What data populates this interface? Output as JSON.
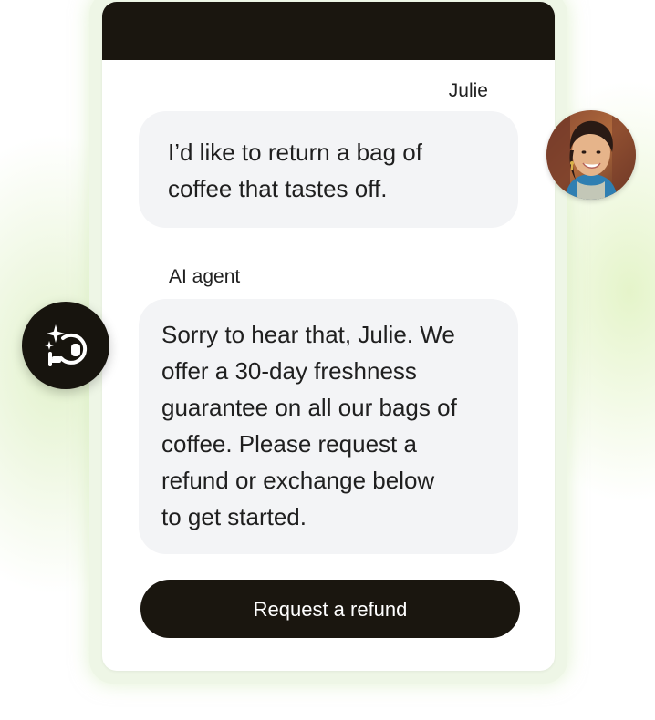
{
  "chat": {
    "messages": [
      {
        "sender": "Julie",
        "text": "I'd like to return a bag of coffee that tastes off.",
        "line1": "I’d like to return a bag of",
        "line2": "coffee that tastes off."
      },
      {
        "sender": "AI agent",
        "line1": "Sorry to hear that, Julie. We",
        "line2": "offer a 30-day freshness",
        "line3": "guarantee on all our bags of",
        "line4": "coffee. Please request a",
        "line5": "refund or exchange below",
        "line6": "to get started."
      }
    ],
    "action_button_label": "Request a refund"
  },
  "icons": {
    "agent_badge": "ai-agent-headset-sparkle-icon",
    "user_avatar": "user-avatar-photo"
  },
  "colors": {
    "header": "#1a160f",
    "button": "#1a160f",
    "bubble": "#f3f4f6",
    "glow": "#e2f3c4"
  }
}
